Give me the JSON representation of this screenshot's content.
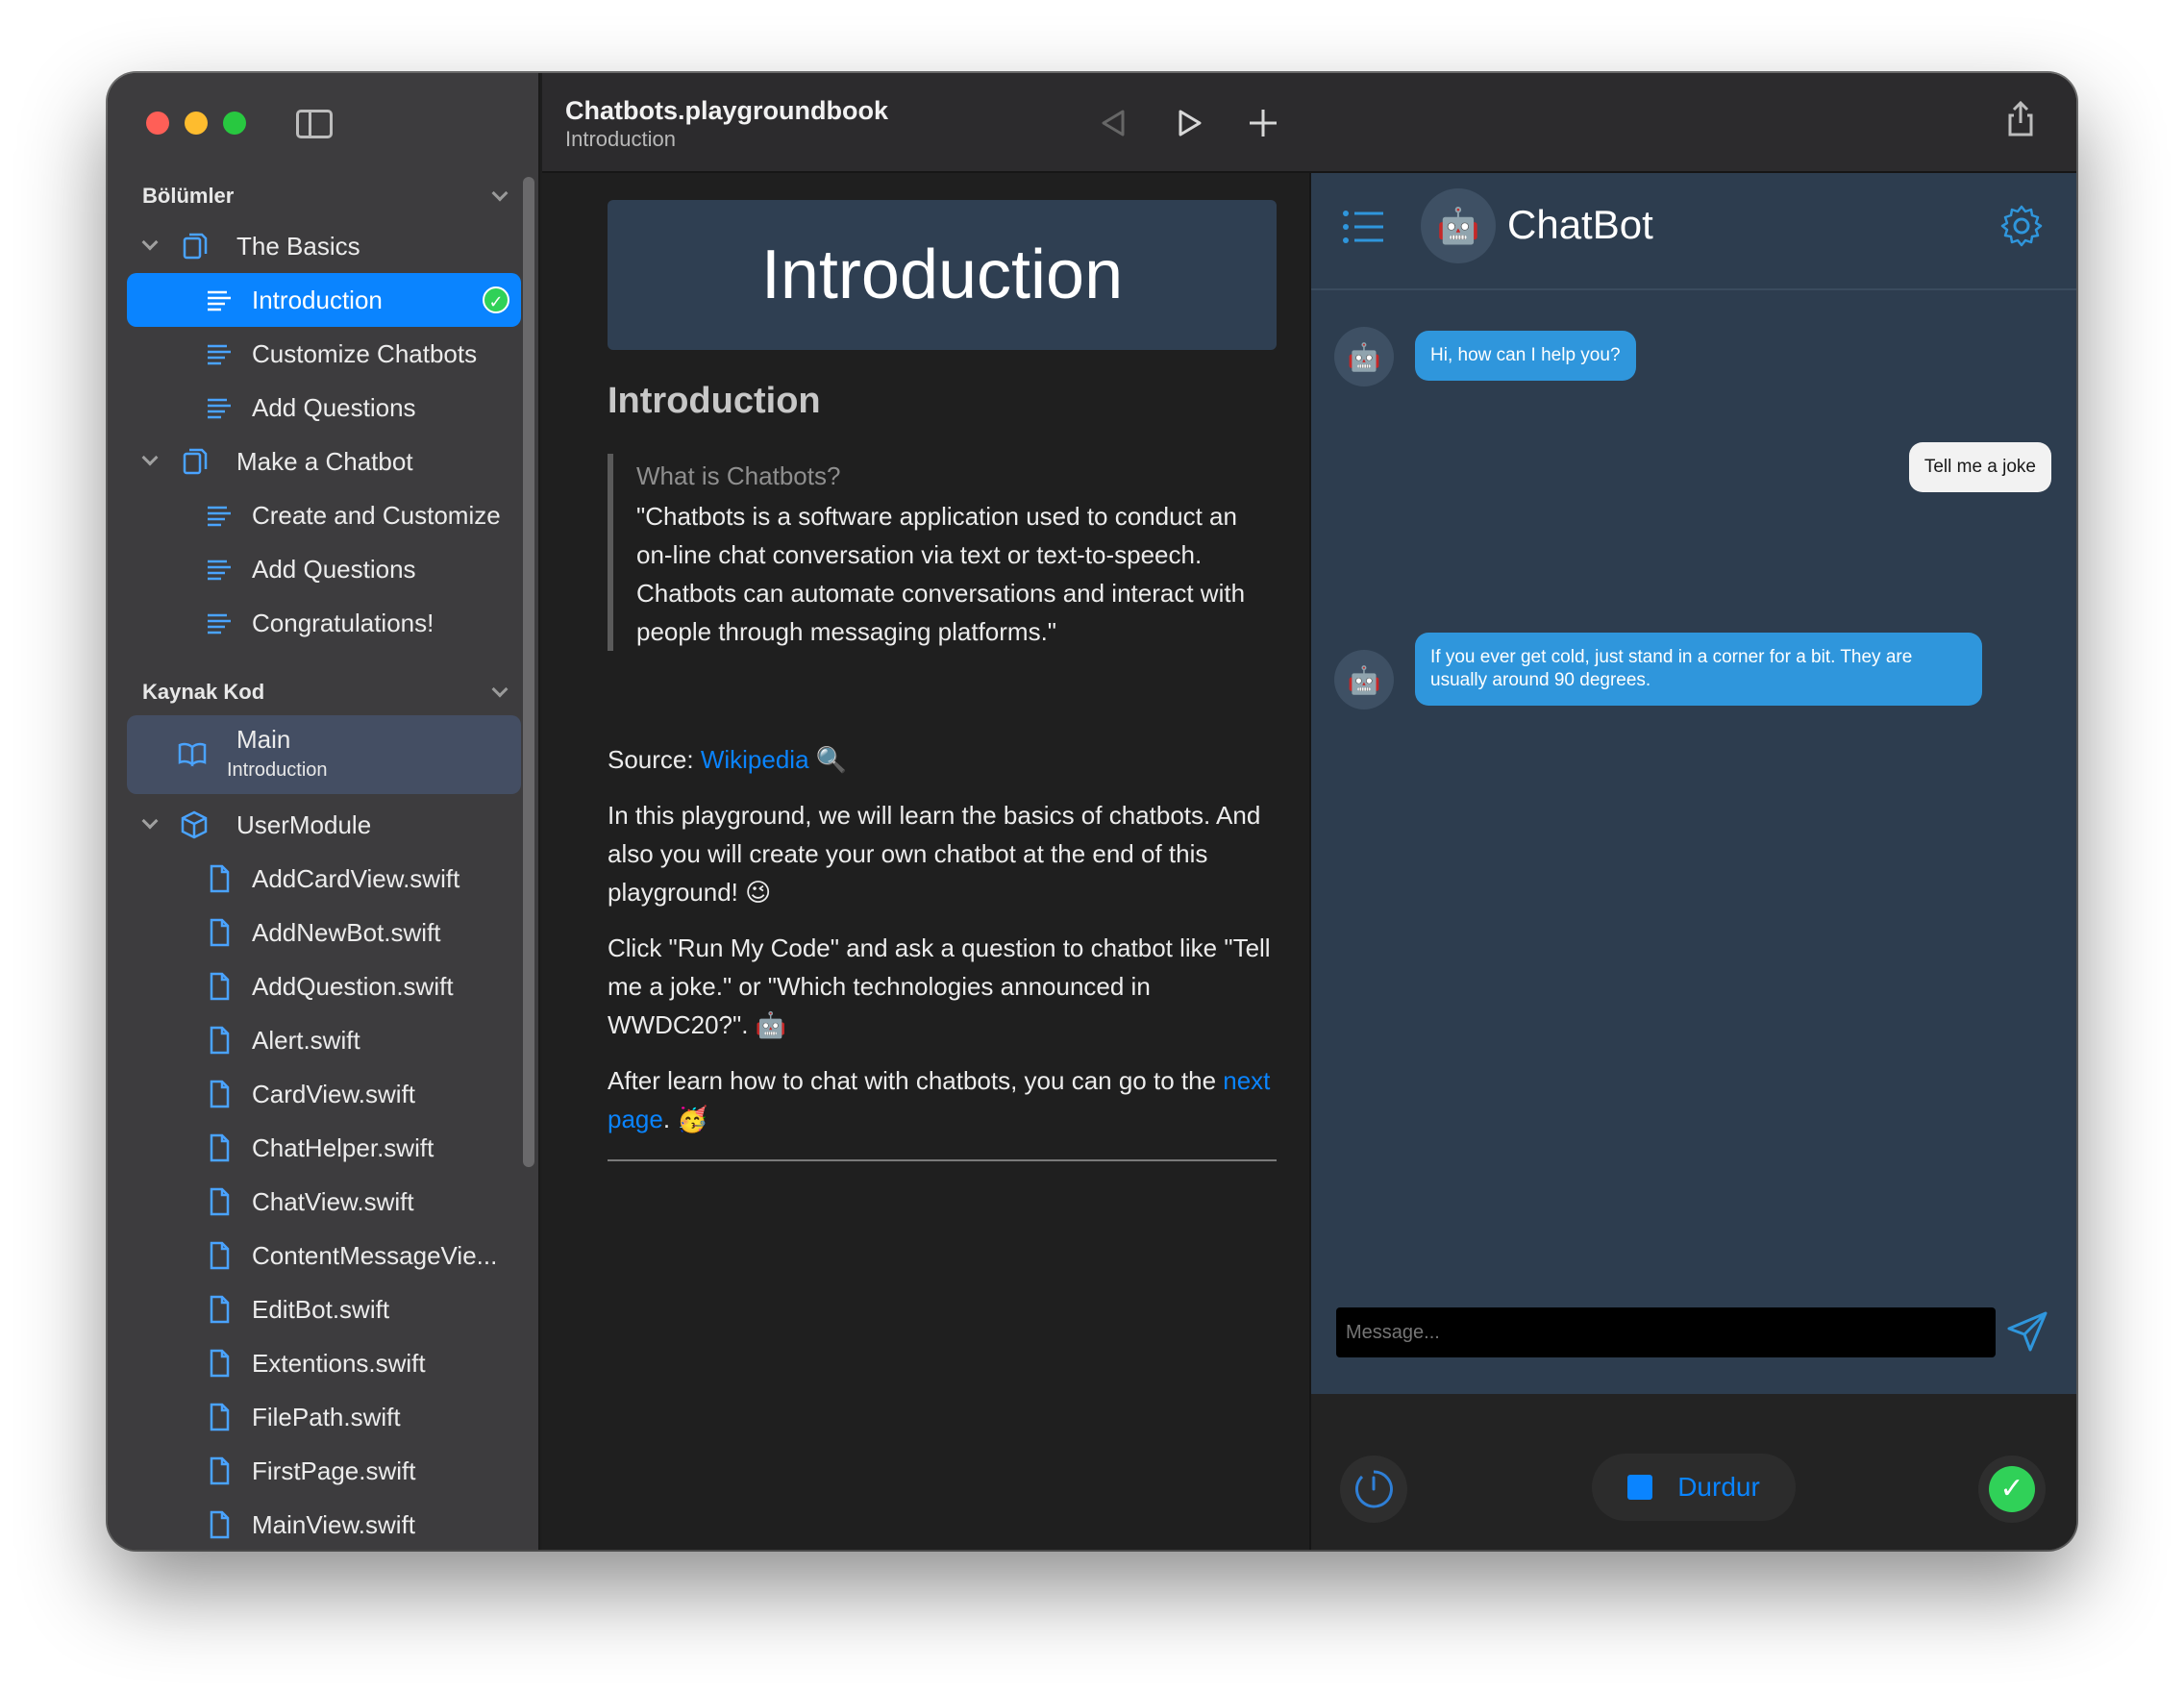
{
  "toolbar": {
    "title": "Chatbots.playgroundbook",
    "subtitle": "Introduction"
  },
  "sidebar": {
    "sections_label": "Bölümler",
    "chapters": [
      {
        "label": "The Basics",
        "pages": [
          "Introduction",
          "Customize Chatbots",
          "Add Questions"
        ]
      },
      {
        "label": "Make a Chatbot",
        "pages": [
          "Create and Customize",
          "Add Questions",
          "Congratulations!"
        ]
      }
    ],
    "source_label": "Kaynak Kod",
    "main_item": {
      "label": "Main",
      "sub": "Introduction"
    },
    "module_label": "UserModule",
    "files": [
      "AddCardView.swift",
      "AddNewBot.swift",
      "AddQuestion.swift",
      "Alert.swift",
      "CardView.swift",
      "ChatHelper.swift",
      "ChatView.swift",
      "ContentMessageVie...",
      "EditBot.swift",
      "Extentions.swift",
      "FilePath.swift",
      "FirstPage.swift",
      "MainView.swift"
    ]
  },
  "content": {
    "banner": "Introduction",
    "heading": "Introduction",
    "quote_title": "What is Chatbots?",
    "quote_text": "\"Chatbots is a software application used to conduct an on-line chat conversation via text or text-to-speech. Chatbots can automate conversations and interact with people through messaging platforms.\"",
    "source_prefix": "Source: ",
    "source_link": "Wikipedia",
    "source_emoji": "🔍",
    "para1": "In this playground, we will learn the basics of chatbots. And also you will create your own chatbot at the end of this playground! 😉",
    "para2": "Click \"Run My Code\" and ask a question to chatbot like \"Tell me a joke.\" or \"Which technologies announced in WWDC20?\". 🤖",
    "para3_prefix": "After learn how to chat with chatbots, you can go to the ",
    "para3_link": "next page",
    "para3_suffix": ". 🥳"
  },
  "chat": {
    "title": "ChatBot",
    "messages": [
      {
        "from": "bot",
        "text": "Hi, how can I help you?"
      },
      {
        "from": "user",
        "text": "Tell me a joke"
      },
      {
        "from": "bot",
        "text": "If you ever get cold, just stand in a corner for a bit. They are usually around 90 degrees."
      }
    ],
    "input_placeholder": "Message..."
  },
  "bottom": {
    "stop_label": "Durdur"
  },
  "colors": {
    "accent": "#0a84ff",
    "chat_bg": "#2d3d4f",
    "bot_bubble": "#2f96dc",
    "success": "#30d158"
  }
}
